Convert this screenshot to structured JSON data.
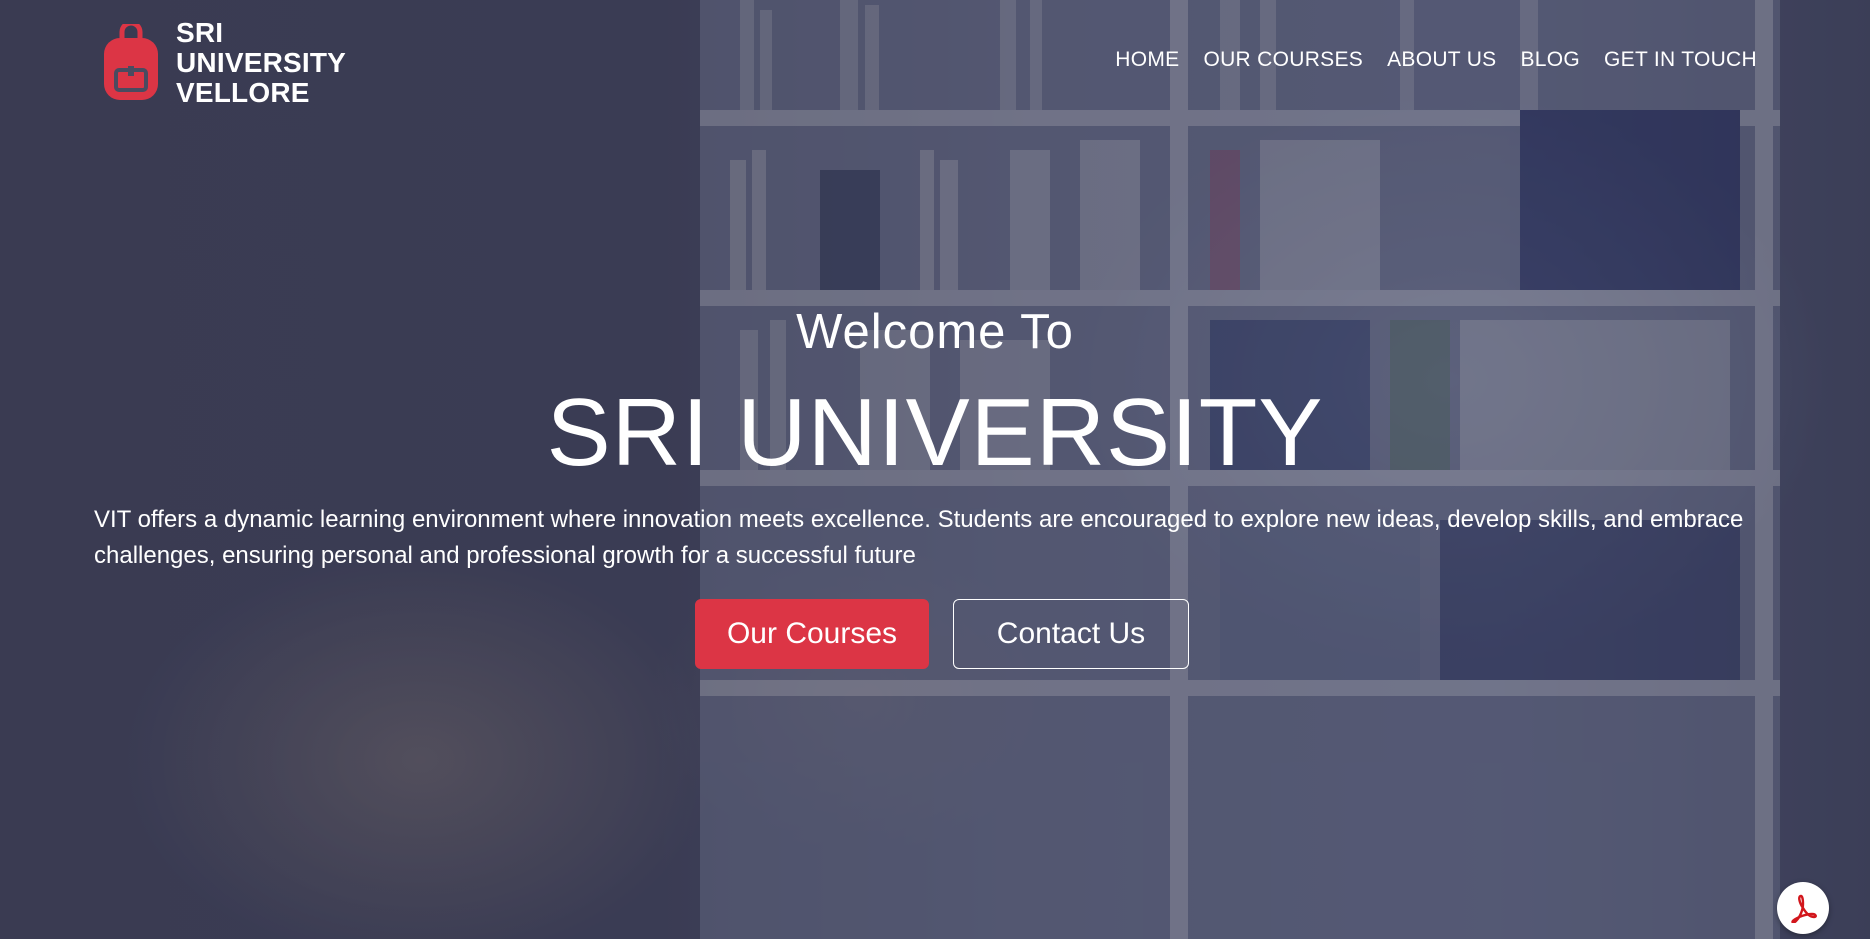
{
  "brand": {
    "lines": [
      "SRI",
      "UNIVERSITY",
      "VELLORE"
    ],
    "icon": "backpack-icon",
    "accent_color": "#dc3545"
  },
  "nav": {
    "items": [
      {
        "label": "HOME"
      },
      {
        "label": "OUR COURSES"
      },
      {
        "label": "ABOUT US"
      },
      {
        "label": "BLOG"
      },
      {
        "label": "GET IN TOUCH"
      }
    ]
  },
  "hero": {
    "welcome": "Welcome To",
    "title": "SRI UNIVERSITY",
    "description": "VIT offers a dynamic learning environment where innovation meets excellence. Students are encouraged to explore new ideas, develop skills, and embrace challenges, ensuring personal and professional growth for a successful future",
    "primary_button": "Our Courses",
    "secondary_button": "Contact Us",
    "primary_color": "#dc3545",
    "background_image": "students-in-library-photo"
  },
  "floating": {
    "icon": "adobe-acrobat-icon"
  }
}
